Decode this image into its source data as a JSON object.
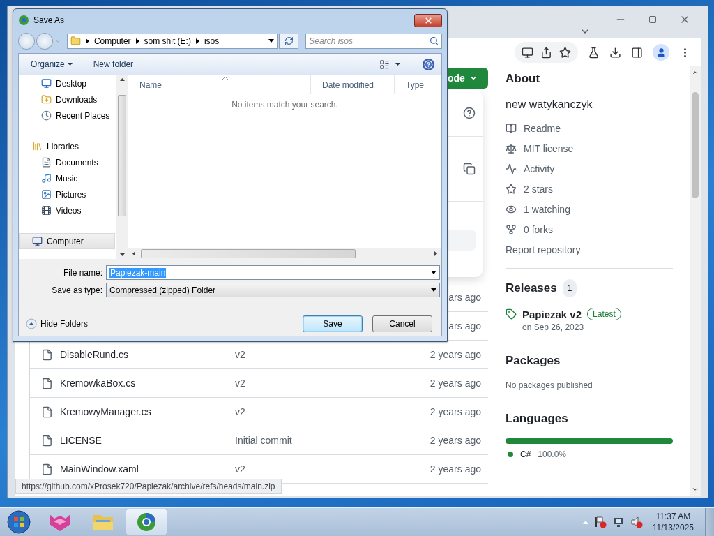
{
  "browser": {
    "code_button": "ode",
    "file_rows": [
      {
        "age": "ars ago"
      },
      {
        "age": "ars ago"
      },
      {
        "name": "DisableRund.cs",
        "message": "v2",
        "age": "2 years ago"
      },
      {
        "name": "KremowkaBox.cs",
        "message": "v2",
        "age": "2 years ago"
      },
      {
        "name": "KremowyManager.cs",
        "message": "v2",
        "age": "2 years ago"
      },
      {
        "name": "LICENSE",
        "message": "Initial commit",
        "age": "2 years ago"
      },
      {
        "name": "MainWindow.xaml",
        "message": "v2",
        "age": "2 years ago"
      }
    ],
    "status_url": "https://github.com/xProsek720/Papiezak/archive/refs/heads/main.zip"
  },
  "about": {
    "title": "About",
    "description": "new watykanczyk",
    "stats": [
      {
        "kind": "readme",
        "label": "Readme"
      },
      {
        "kind": "license",
        "label": "MIT license"
      },
      {
        "kind": "activity",
        "label": "Activity"
      },
      {
        "kind": "stars",
        "label": "2 stars"
      },
      {
        "kind": "watching",
        "label": "1 watching"
      },
      {
        "kind": "forks",
        "label": "0 forks"
      }
    ],
    "report": "Report repository"
  },
  "releases": {
    "title": "Releases",
    "count": "1",
    "items": [
      {
        "name": "Papiezak v2",
        "badge": "Latest",
        "date": "on Sep 26, 2023"
      }
    ]
  },
  "packages": {
    "title": "Packages",
    "note": "No packages published"
  },
  "languages": {
    "title": "Languages",
    "items": [
      {
        "name": "C#",
        "share": "100.0%",
        "level": 1,
        "color": "#1f883d"
      }
    ]
  },
  "dialog": {
    "title": "Save As",
    "path": [
      "Computer",
      "som shit (E:)",
      "isos"
    ],
    "search": {
      "placeholder": "Search isos"
    },
    "toolbar": [
      {
        "kind": "menu",
        "label": "Organize"
      },
      {
        "kind": "button",
        "label": "New folder"
      }
    ],
    "nav": [
      {
        "children": [
          {
            "kind": "desktop",
            "label": "Desktop",
            "selected": false
          },
          {
            "kind": "downloads",
            "label": "Downloads",
            "selected": false
          },
          {
            "kind": "recent",
            "label": "Recent Places",
            "selected": false
          }
        ]
      },
      {
        "kind": "library",
        "label": "Libraries",
        "selected": false,
        "children": [
          {
            "kind": "documents",
            "label": "Documents",
            "selected": false
          },
          {
            "kind": "music",
            "label": "Music",
            "selected": false
          },
          {
            "kind": "pictures",
            "label": "Pictures",
            "selected": false
          },
          {
            "kind": "videos",
            "label": "Videos",
            "selected": false
          }
        ]
      },
      {
        "kind": "computer",
        "label": "Computer",
        "selected": true
      }
    ],
    "columns": [
      "Name",
      "Date modified",
      "Type"
    ],
    "empty_message": "No items match your search.",
    "file_name": {
      "label": "File name:",
      "value": "Papiezak-main",
      "text_selected": true
    },
    "save_type": {
      "label": "Save as type:",
      "value": "Compressed (zipped) Folder"
    },
    "hide_folders": "Hide Folders",
    "buttons": [
      {
        "label": "Save",
        "default": true
      },
      {
        "label": "Cancel",
        "default": false
      }
    ]
  },
  "taskbar": {
    "apps": [
      {
        "kind": "cube",
        "selected": false
      },
      {
        "kind": "folder",
        "selected": false
      },
      {
        "kind": "browser",
        "selected": true
      }
    ],
    "time": "11:37 AM",
    "date": "11/13/2025"
  }
}
